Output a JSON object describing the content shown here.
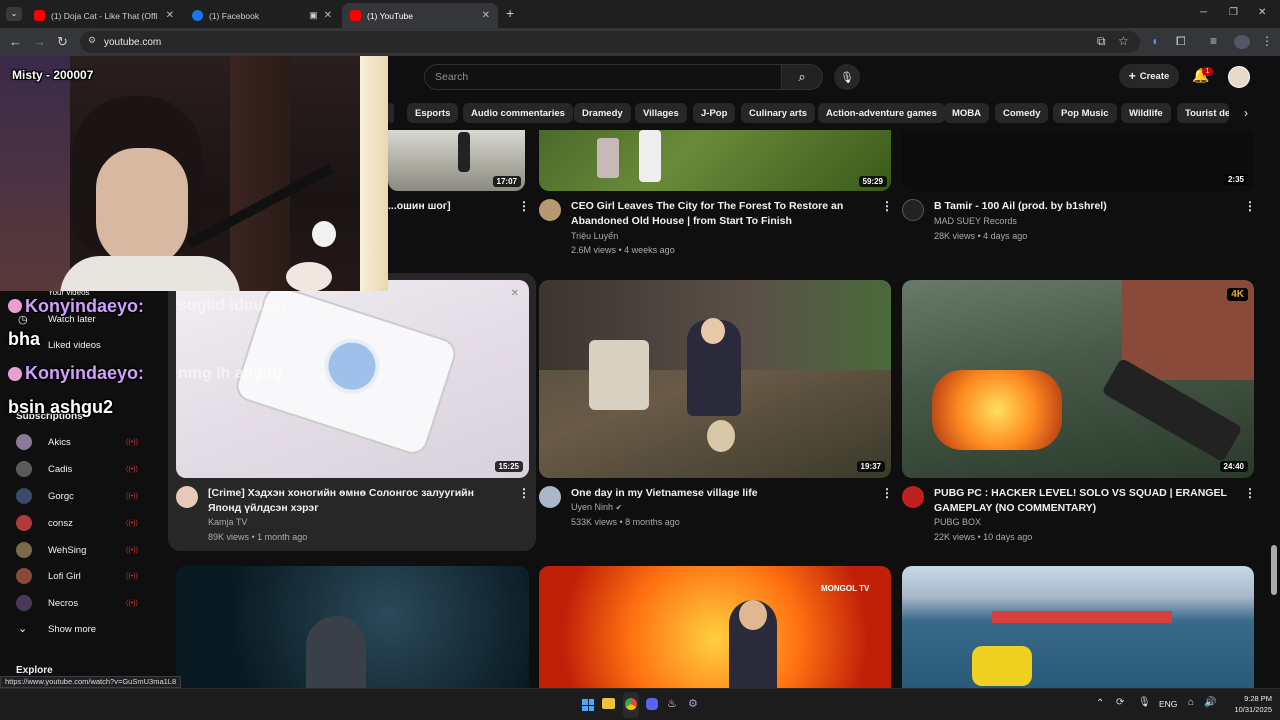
{
  "browser": {
    "tabs": [
      {
        "title": "(1) Doja Cat - Like That (Offi",
        "favicon_color": "#ff0000"
      },
      {
        "title": "(1) Facebook",
        "favicon_color": "#1877f2"
      },
      {
        "title": "(1) YouTube",
        "favicon_color": "#ff0000"
      }
    ],
    "new_tab": "+",
    "url": "youtube.com",
    "window_controls": {
      "minimize": "─",
      "maximize": "❐",
      "close": "✕"
    }
  },
  "header": {
    "search_placeholder": "Search",
    "create_label": "Create",
    "notification_count": "1"
  },
  "chips": [
    "Esports",
    "Audio commentaries",
    "Dramedy",
    "Villages",
    "J-Pop",
    "Culinary arts",
    "Action-adventure games",
    "MOBA",
    "Comedy",
    "Pop Music",
    "Wildlife",
    "Tourist de"
  ],
  "row1": [
    {
      "title": "...ошин шог]",
      "duration": "17:07"
    },
    {
      "title": "CEO Girl Leaves The City for The Forest To Restore an Abandoned Old House | from Start To Finish",
      "channel": "Triệu Luyến",
      "meta": "2.6M views • 4 weeks ago",
      "duration": "59:29"
    },
    {
      "title": "B Tamir - 100 Ail (prod. by b1shrel)",
      "channel": "MAD SUEY Records",
      "meta": "28K views • 4 days ago",
      "duration": "2:35"
    }
  ],
  "row2": [
    {
      "title": "[Crime] Хэдхэн хоногийн өмнө Солонгос залуугийн Японд үйлдсэн хэрэг",
      "channel": "Kamja TV",
      "meta": "89K views • 1 month ago",
      "duration": "15:25"
    },
    {
      "title": "One day in my Vietnamese village life",
      "channel": "Uyen Ninh",
      "meta": "533K views • 8 months ago",
      "duration": "19:37"
    },
    {
      "title": "PUBG PC : HACKER LEVEL! SOLO VS SQUAD | ERANGEL GAMEPLAY (NO COMMENTARY)",
      "channel": "PUBG BOX",
      "meta": "22K views • 10 days ago",
      "duration": "24:40",
      "badge": "4K"
    }
  ],
  "sidebar": {
    "your_videos": "Your videos",
    "watch_later": "Watch later",
    "liked_videos": "Liked videos",
    "subscriptions_heading": "Subscriptions",
    "subscriptions": [
      {
        "name": "Akics",
        "color": "#8a7a9a"
      },
      {
        "name": "Cadis",
        "color": "#5a5a5a"
      },
      {
        "name": "Gorgc",
        "color": "#3a4a6a"
      },
      {
        "name": "consz",
        "color": "#b03a3a"
      },
      {
        "name": "WehSing",
        "color": "#7a6a4a"
      },
      {
        "name": "Lofi Girl",
        "color": "#8a4a3a"
      },
      {
        "name": "Necros",
        "color": "#4a3a5a"
      }
    ],
    "show_more": "Show more",
    "explore": "Explore"
  },
  "stream_overlay": {
    "streamer_name": "Misty - 200007",
    "chat": [
      {
        "user": "Konyindaeyo:",
        "msg": "bha"
      },
      {
        "user": "Konyindaeyo:",
        "msg": "bsin ashgu2"
      }
    ],
    "faded_text_1": "sugiid iduulsn",
    "faded_text_2": "nmg ih ailgdg"
  },
  "status_url": "https://www.youtube.com/watch?v=GuSmU3ma1L8",
  "row3_watermark": "MONGOL TV",
  "taskbar": {
    "lang": "ENG",
    "time": "9:28 PM",
    "date": "10/31/2025"
  }
}
